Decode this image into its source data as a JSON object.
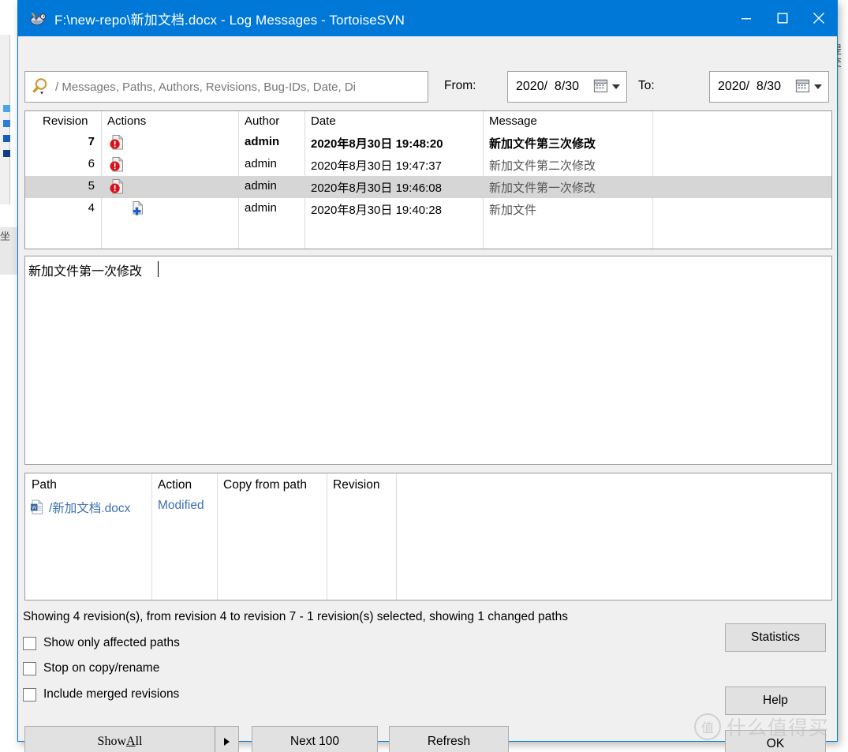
{
  "background": {
    "left_label": "坐",
    "right_label": "提交"
  },
  "window": {
    "title": "F:\\new-repo\\新加文档.docx - Log Messages - TortoiseSVN",
    "icon": "tortoisesvn-icon",
    "controls": {
      "minimize": "minimize-icon",
      "maximize": "maximize-icon",
      "close": "close-icon"
    }
  },
  "filter": {
    "search_placeholder": "/ Messages, Paths, Authors, Revisions, Bug-IDs, Date, Di",
    "search_value": "",
    "search_icon": "search-icon",
    "from_label": "From:",
    "from_value": "2020/  8/30",
    "to_label": "To:",
    "to_value": "2020/  8/30",
    "calendar_icon": "calendar-icon"
  },
  "log_table": {
    "columns": [
      "Revision",
      "Actions",
      "Author",
      "Date",
      "Message"
    ],
    "rows": [
      {
        "revision": "7",
        "action_icon": "modified-file-icon",
        "author": "admin",
        "date": "2020年8月30日 19:48:20",
        "message": "新加文件第三次修改",
        "bold": true,
        "selected": false
      },
      {
        "revision": "6",
        "action_icon": "modified-file-icon",
        "author": "admin",
        "date": "2020年8月30日 19:47:37",
        "message": "新加文件第二次修改",
        "bold": false,
        "selected": false
      },
      {
        "revision": "5",
        "action_icon": "modified-file-icon",
        "author": "admin",
        "date": "2020年8月30日 19:46:08",
        "message": "新加文件第一次修改",
        "bold": false,
        "selected": true
      },
      {
        "revision": "4",
        "action_icon": "added-file-icon",
        "author": "admin",
        "date": "2020年8月30日 19:40:28",
        "message": "新加文件",
        "bold": false,
        "selected": false
      }
    ]
  },
  "message_box": {
    "value": "新加文件第一次修改"
  },
  "paths_table": {
    "columns": [
      "Path",
      "Action",
      "Copy from path",
      "Revision"
    ],
    "rows": [
      {
        "file_icon": "word-document-icon",
        "path": "/新加文档.docx",
        "action": "Modified",
        "copy_from_path": "",
        "revision": ""
      }
    ]
  },
  "status": {
    "text": "Showing 4 revision(s), from revision 4 to revision 7 - 1 revision(s) selected, showing 1 changed paths"
  },
  "options": [
    {
      "label": "Show only affected paths",
      "checked": false
    },
    {
      "label": "Stop on copy/rename",
      "checked": false
    },
    {
      "label": "Include merged revisions",
      "checked": false
    }
  ],
  "buttons": {
    "show_all_prefix": "Show ",
    "show_all_accel": "A",
    "show_all_suffix": "ll",
    "next_100": "Next 100",
    "refresh": "Refresh",
    "statistics": "Statistics",
    "help": "Help",
    "ok": "OK"
  },
  "watermark": {
    "logo": "值",
    "text": "什么值得买"
  },
  "colors": {
    "titlebar": "#0078d7",
    "dialog_bg": "#f0f0f0",
    "selection": "#d6d6d6",
    "link": "#3b6fb5"
  }
}
